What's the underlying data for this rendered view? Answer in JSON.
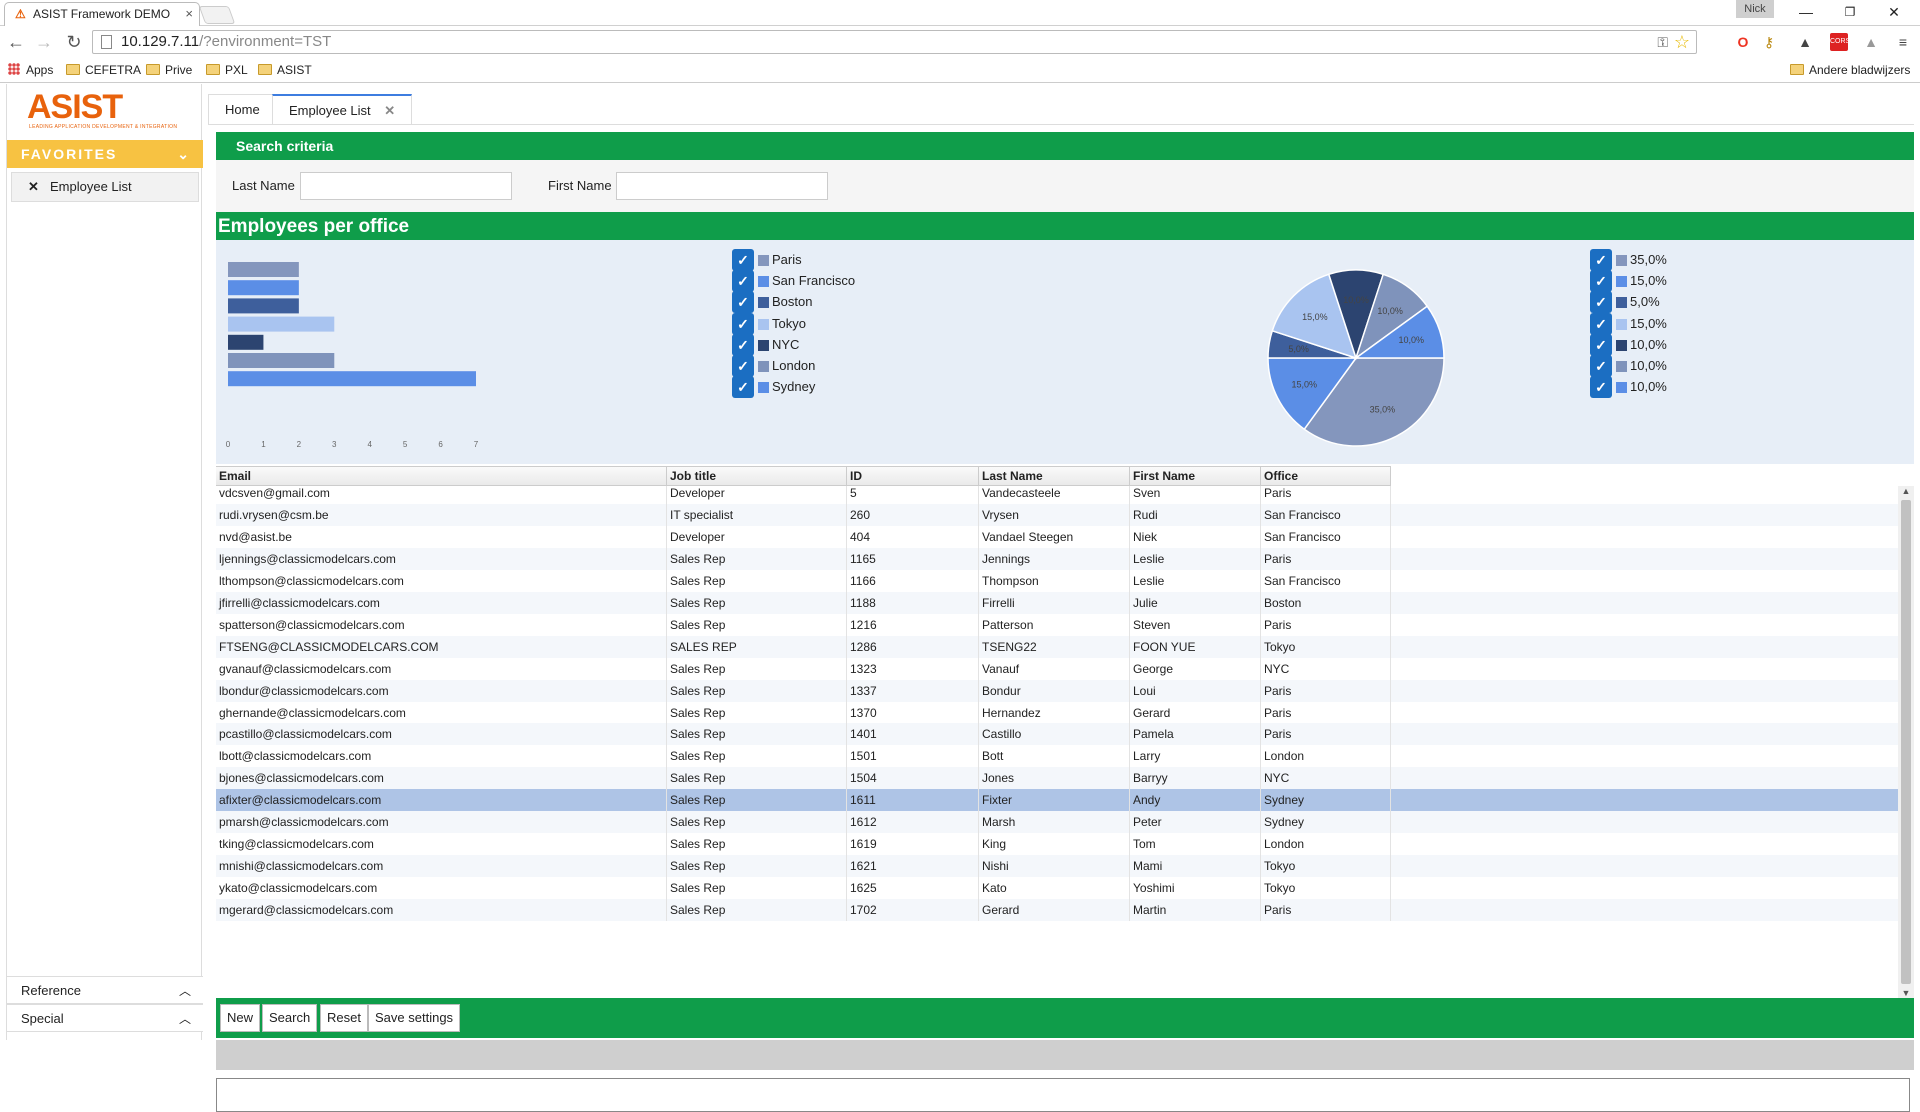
{
  "browser": {
    "tab_title": "ASIST Framework DEMO",
    "tab_close": "×",
    "user": "Nick",
    "url_host": "10.129.7.11",
    "url_path": "/?environment=TST",
    "bookmarks": [
      "Apps",
      "CEFETRA",
      "Prive",
      "PXL",
      "ASIST"
    ],
    "other_bookmarks": "Andere bladwijzers",
    "window_buttons": [
      "—",
      "❐",
      "✕"
    ]
  },
  "logo": {
    "name": "ASIST",
    "tagline": "LEADING APPLICATION DEVELOPMENT & INTEGRATION"
  },
  "sidebar": {
    "favorites_label": "FAVORITES",
    "favorites_items": [
      {
        "label": "Employee List"
      }
    ],
    "sections": [
      {
        "label": "Reference"
      },
      {
        "label": "Special"
      }
    ]
  },
  "tabs": [
    {
      "label": "Home",
      "active": false
    },
    {
      "label": "Employee List",
      "active": true
    }
  ],
  "search": {
    "title": "Search criteria",
    "last_name_label": "Last Name",
    "last_name_value": "",
    "first_name_label": "First Name",
    "first_name_value": ""
  },
  "colors": {
    "green": "#0f9d4a",
    "favorites": "#f7c242",
    "selected_row": "#aec4e6",
    "check": "#1b6ec2"
  },
  "chart_panel_title": "Employees per office",
  "chart_data": [
    {
      "type": "bar",
      "orientation": "horizontal",
      "categories": [
        "Paris",
        "San Francisco",
        "Boston",
        "Tokyo",
        "NYC",
        "London",
        "Sydney"
      ],
      "values": [
        2,
        2,
        2,
        3,
        1,
        3,
        7
      ],
      "colors": [
        "#8496bd",
        "#5b8ee6",
        "#3e5f9c",
        "#a9c4f0",
        "#2c4470",
        "#7f93bb",
        "#5b8ee6"
      ],
      "xlim": [
        0,
        7
      ],
      "xticks": [
        "0",
        "1",
        "2",
        "3",
        "4",
        "5",
        "6",
        "7"
      ],
      "legend": [
        "Paris",
        "San Francisco",
        "Boston",
        "Tokyo",
        "NYC",
        "London",
        "Sydney"
      ]
    },
    {
      "type": "pie",
      "labels": [
        "35,0%",
        "15,0%",
        "5,0%",
        "15,0%",
        "10,0%",
        "10,0%",
        "10,0%"
      ],
      "values": [
        35,
        15,
        5,
        15,
        10,
        10,
        10
      ],
      "colors": [
        "#8496bd",
        "#5b8ee6",
        "#3e5f9c",
        "#a9c4f0",
        "#2c4470",
        "#7f93bb",
        "#5b8ee6"
      ],
      "legend": [
        "35,0%",
        "15,0%",
        "5,0%",
        "15,0%",
        "10,0%",
        "10,0%",
        "10,0%"
      ]
    }
  ],
  "grid": {
    "columns": [
      "Email",
      "Job title",
      "ID",
      "Last Name",
      "First Name",
      "Office"
    ],
    "rows": [
      [
        "vdcsven@gmail.com",
        "Developer",
        "5",
        "Vandecasteele",
        "Sven",
        "Paris"
      ],
      [
        "rudi.vrysen@csm.be",
        "IT specialist",
        "260",
        "Vrysen",
        "Rudi",
        "San Francisco"
      ],
      [
        "nvd@asist.be",
        "Developer",
        "404",
        "Vandael Steegen",
        "Niek",
        "San Francisco"
      ],
      [
        "ljennings@classicmodelcars.com",
        "Sales Rep",
        "1165",
        "Jennings",
        "Leslie",
        "Paris"
      ],
      [
        "lthompson@classicmodelcars.com",
        "Sales Rep",
        "1166",
        "Thompson",
        "Leslie",
        "San Francisco"
      ],
      [
        "jfirrelli@classicmodelcars.com",
        "Sales Rep",
        "1188",
        "Firrelli",
        "Julie",
        "Boston"
      ],
      [
        "spatterson@classicmodelcars.com",
        "Sales Rep",
        "1216",
        "Patterson",
        "Steven",
        "Paris"
      ],
      [
        "FTSENG@CLASSICMODELCARS.COM",
        "SALES REP",
        "1286",
        "TSENG22",
        "FOON YUE",
        "Tokyo"
      ],
      [
        "gvanauf@classicmodelcars.com",
        "Sales Rep",
        "1323",
        "Vanauf",
        "George",
        "NYC"
      ],
      [
        "lbondur@classicmodelcars.com",
        "Sales Rep",
        "1337",
        "Bondur",
        "Loui",
        "Paris"
      ],
      [
        "ghernande@classicmodelcars.com",
        "Sales Rep",
        "1370",
        "Hernandez",
        "Gerard",
        "Paris"
      ],
      [
        "pcastillo@classicmodelcars.com",
        "Sales Rep",
        "1401",
        "Castillo",
        "Pamela",
        "Paris"
      ],
      [
        "lbott@classicmodelcars.com",
        "Sales Rep",
        "1501",
        "Bott",
        "Larry",
        "London"
      ],
      [
        "bjones@classicmodelcars.com",
        "Sales Rep",
        "1504",
        "Jones",
        "Barryy",
        "NYC"
      ],
      [
        "afixter@classicmodelcars.com",
        "Sales Rep",
        "1611",
        "Fixter",
        "Andy",
        "Sydney"
      ],
      [
        "pmarsh@classicmodelcars.com",
        "Sales Rep",
        "1612",
        "Marsh",
        "Peter",
        "Sydney"
      ],
      [
        "tking@classicmodelcars.com",
        "Sales Rep",
        "1619",
        "King",
        "Tom",
        "London"
      ],
      [
        "mnishi@classicmodelcars.com",
        "Sales Rep",
        "1621",
        "Nishi",
        "Mami",
        "Tokyo"
      ],
      [
        "ykato@classicmodelcars.com",
        "Sales Rep",
        "1625",
        "Kato",
        "Yoshimi",
        "Tokyo"
      ],
      [
        "mgerard@classicmodelcars.com",
        "Sales Rep",
        "1702",
        "Gerard",
        "Martin",
        "Paris"
      ]
    ],
    "selected_row": 14
  },
  "buttons": {
    "new": "New",
    "search": "Search",
    "reset": "Reset",
    "save_settings": "Save settings"
  },
  "status_field_value": ""
}
